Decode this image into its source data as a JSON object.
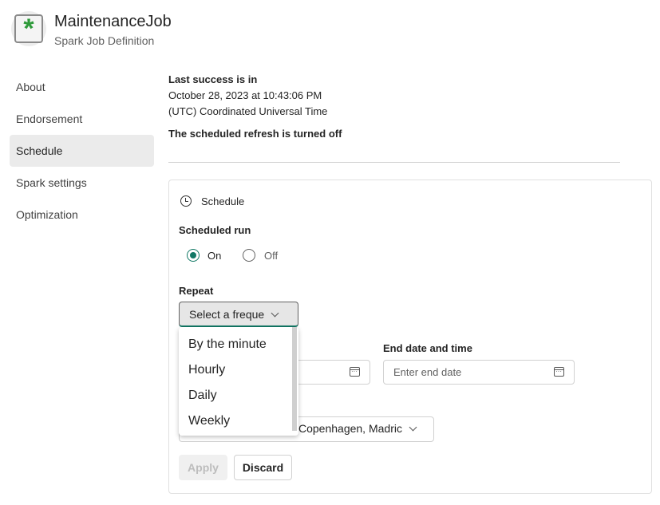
{
  "header": {
    "title": "MaintenanceJob",
    "subtitle": "Spark Job Definition",
    "logo_icon": "asterisk-icon"
  },
  "sidebar": {
    "items": [
      {
        "label": "About"
      },
      {
        "label": "Endorsement"
      },
      {
        "label": "Schedule",
        "selected": true
      },
      {
        "label": "Spark settings"
      },
      {
        "label": "Optimization"
      }
    ]
  },
  "status": {
    "last_success_label": "Last success is in",
    "last_success_date": "October 28, 2023 at 10:43:06 PM",
    "timezone": "(UTC) Coordinated Universal Time",
    "refresh_status": "The scheduled refresh is turned off"
  },
  "schedule": {
    "heading": "Schedule",
    "scheduled_run_label": "Scheduled run",
    "radio_on": "On",
    "radio_off": "Off",
    "selected": "On",
    "repeat_label": "Repeat",
    "repeat_value": "Select a freque",
    "repeat_options": [
      "By the minute",
      "Hourly",
      "Daily",
      "Weekly"
    ],
    "end_label": "End date and time",
    "end_placeholder": "Enter end date",
    "timezone_value": "Copenhagen, Madric",
    "apply_label": "Apply",
    "discard_label": "Discard",
    "accent_color": "#117865"
  }
}
